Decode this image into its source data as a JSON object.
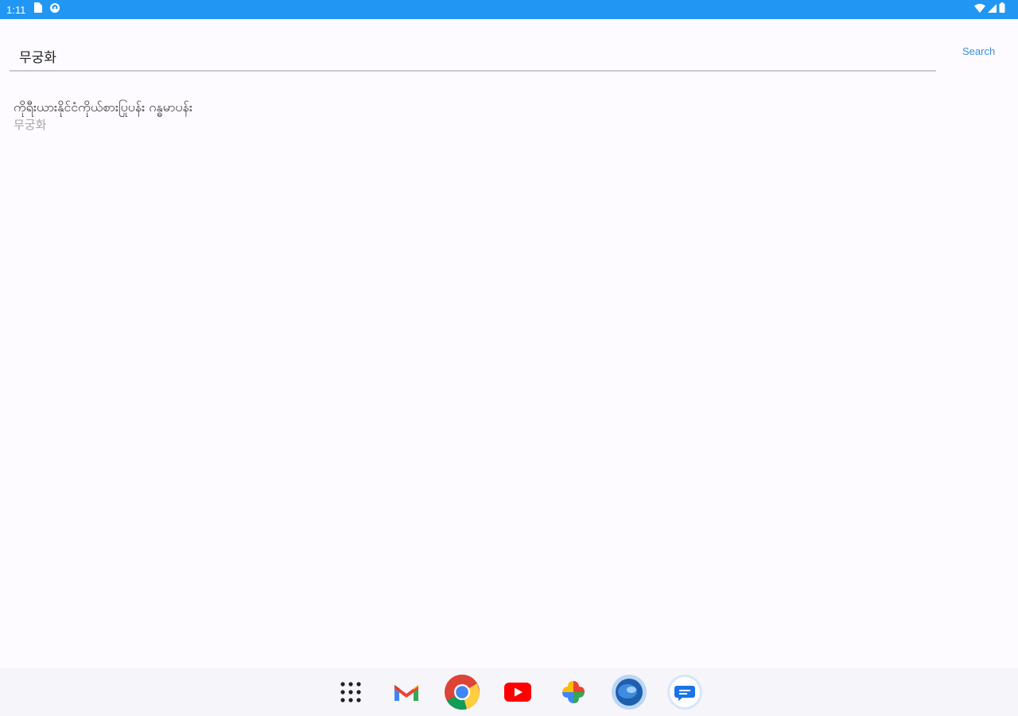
{
  "status_bar": {
    "time": "1:11",
    "left_icons": [
      "sim-card-icon",
      "vpn-icon"
    ],
    "right_icons": [
      "wifi-icon",
      "cellular-signal-icon",
      "battery-icon"
    ],
    "bar_color": "#2196f3"
  },
  "search": {
    "value": "무궁화",
    "button_label": "Search",
    "button_color": "#3a8ed8"
  },
  "results": [
    {
      "title": "ကိုရီးယားနိုင်ငံကိုယ်စားပြုပန်း ဂန္ဓမာပန်း",
      "subtitle": "무궁화"
    }
  ],
  "dock": {
    "apps": [
      "app-drawer-icon",
      "gmail-icon",
      "chrome-icon",
      "youtube-icon",
      "photos-icon",
      "globe-app-icon",
      "messages-icon"
    ]
  }
}
